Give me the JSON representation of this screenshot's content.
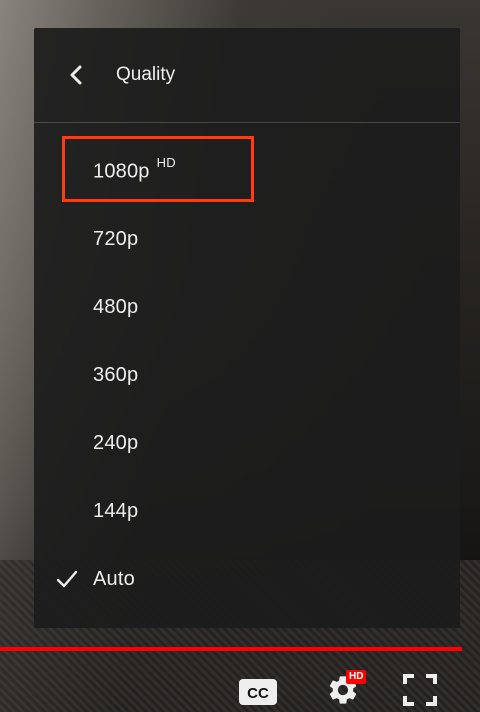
{
  "menu": {
    "title": "Quality",
    "items": [
      {
        "label": "1080p",
        "superscript": "HD",
        "selected": false,
        "highlighted": true
      },
      {
        "label": "720p",
        "selected": false
      },
      {
        "label": "480p",
        "selected": false
      },
      {
        "label": "360p",
        "selected": false
      },
      {
        "label": "240p",
        "selected": false
      },
      {
        "label": "144p",
        "selected": false
      },
      {
        "label": "Auto",
        "selected": true
      }
    ]
  },
  "controls": {
    "cc_label": "CC",
    "settings_badge": "HD"
  },
  "colors": {
    "progress": "#ff0000",
    "highlight": "#ff3b0f",
    "badge": "#ff0000"
  }
}
